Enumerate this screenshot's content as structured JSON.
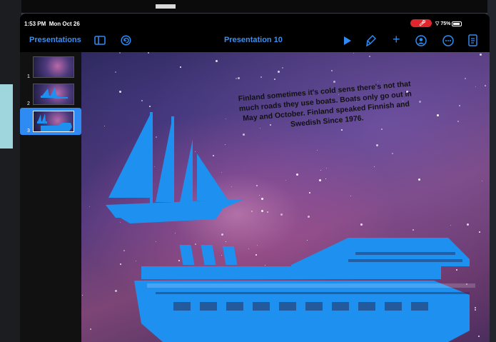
{
  "status": {
    "time": "1:53 PM",
    "date": "Mon Oct 26",
    "battery": "75%"
  },
  "toolbar": {
    "back_label": "Presentations",
    "title": "Presentation 10"
  },
  "navigator": {
    "slides": [
      {
        "number": "1",
        "selected": false
      },
      {
        "number": "2",
        "selected": false
      },
      {
        "number": "3",
        "selected": true
      }
    ]
  },
  "slide": {
    "body_text": "Finland sometimes it's cold sens there's not that much roads they use boats. Boats only go out in May and October. Finland speaked Finnish and Swedish Since 1976."
  },
  "colors": {
    "accent": "#2d8bf3",
    "shape_fill": "#1e90f0",
    "recording": "#e0262d"
  },
  "icons": [
    "sidebar-toggle-icon",
    "undo-icon",
    "play-icon",
    "format-brush-icon",
    "add-icon",
    "collaborate-icon",
    "more-icon",
    "document-icon",
    "wifi-icon",
    "battery-icon",
    "mic-icon"
  ]
}
